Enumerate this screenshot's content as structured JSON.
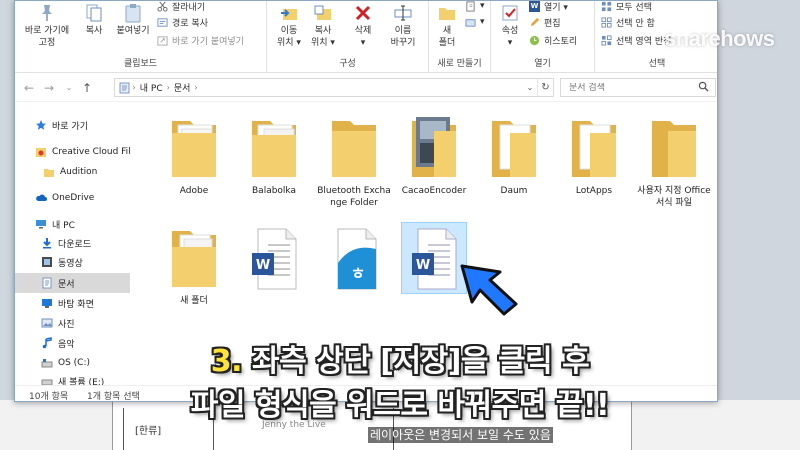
{
  "ribbon": {
    "clipboard": {
      "pin_label_1": "바로 가기에",
      "pin_label_2": "고정",
      "copy": "복사",
      "paste": "붙여넣기",
      "cut": "잘라내기",
      "copy_path": "경로 복사",
      "paste_shortcut": "바로 가기 붙여넣기",
      "group_label": "클립보드"
    },
    "organize": {
      "move_1": "이동",
      "move_2": "위치 ▾",
      "copyto_1": "복사",
      "copyto_2": "위치 ▾",
      "delete_1": "삭제",
      "delete_2": "▾",
      "rename_1": "이름",
      "rename_2": "바꾸기",
      "group_label": "구성"
    },
    "new": {
      "newfolder_1": "새",
      "newfolder_2": "폴더",
      "group_label": "새로 만들기"
    },
    "open": {
      "properties_1": "속성",
      "properties_2": "▾",
      "open_label": "열기 ▾",
      "edit_label": "편집",
      "history_label": "히스토리",
      "group_label": "열기"
    },
    "select": {
      "select_all": "모두 선택",
      "select_none": "선택 안 함",
      "invert_selection": "선택 영역 반전",
      "group_label": "선택"
    }
  },
  "address": {
    "crumbs": [
      "내 PC",
      "문서"
    ],
    "search_placeholder": "문서 검색"
  },
  "nav": {
    "items": [
      {
        "label": "바로 가기"
      },
      {
        "label": "Creative Cloud Fil"
      },
      {
        "label": "Audition"
      },
      {
        "label": "OneDrive"
      },
      {
        "label": "내 PC"
      },
      {
        "label": "다운로드"
      },
      {
        "label": "동영상"
      },
      {
        "label": "문서"
      },
      {
        "label": "바탕 화면"
      },
      {
        "label": "사진"
      },
      {
        "label": "음악"
      },
      {
        "label": "OS (C:)"
      },
      {
        "label": "새 볼륨 (E:)"
      }
    ]
  },
  "files": [
    {
      "name": "Adobe"
    },
    {
      "name": "Balabolka"
    },
    {
      "name": "Bluetooth Exchange Folder"
    },
    {
      "name": "CacaoEncoder"
    },
    {
      "name": "Daum"
    },
    {
      "name": "LotApps"
    },
    {
      "name": "사용자 지정 Office 서식 파일"
    },
    {
      "name": "새 폴더"
    },
    {
      "name": ""
    },
    {
      "name": ""
    },
    {
      "name": ""
    }
  ],
  "status": {
    "count": "10개 항목",
    "selected": "1개 항목 선택"
  },
  "document": {
    "cell_a": "[한류]",
    "cell_b": "Jenny the Live"
  },
  "overlay": {
    "watermark": "sharehows",
    "caption_num": "3.",
    "caption_line1": " 좌측 상단 [저장]을 클릭 후",
    "caption_line2": "파일 형식을 워드로 바꿔주면 끝!!",
    "note": "레이아웃은 변경되서 보일 수도 있음"
  },
  "colors": {
    "folder": "#f3cf6d",
    "folder_dark": "#e1b24a",
    "word_blue": "#2b579a",
    "hangul_blue": "#1f8fd6",
    "arrow_blue": "#1f78ff",
    "selection": "#cce8ff"
  }
}
